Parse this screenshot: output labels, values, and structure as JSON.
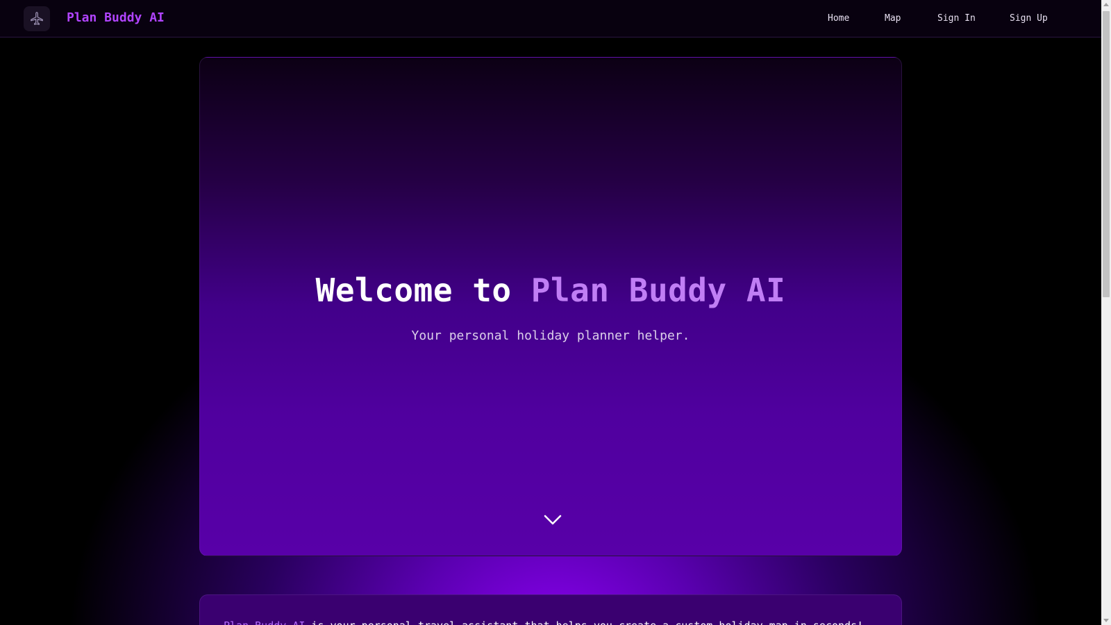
{
  "nav": {
    "brand": "Plan Buddy AI",
    "logo_icon": "airplane-icon",
    "links": [
      {
        "label": "Home"
      },
      {
        "label": "Map"
      },
      {
        "label": "Sign In"
      },
      {
        "label": "Sign Up"
      }
    ]
  },
  "hero": {
    "title_prefix": "Welcome to ",
    "title_accent": "Plan Buddy AI",
    "subtitle": "Your personal holiday planner helper.",
    "scroll_icon": "chevron-down-icon"
  },
  "about": {
    "accent": "Plan Buddy AI",
    "text": " is your personal travel assistant that helps you create a custom holiday map in seconds!"
  },
  "colors": {
    "accent": "#b144ff",
    "title_accent": "#c07ef5",
    "background": "#000000",
    "hero_bottom": "#5800a8"
  }
}
